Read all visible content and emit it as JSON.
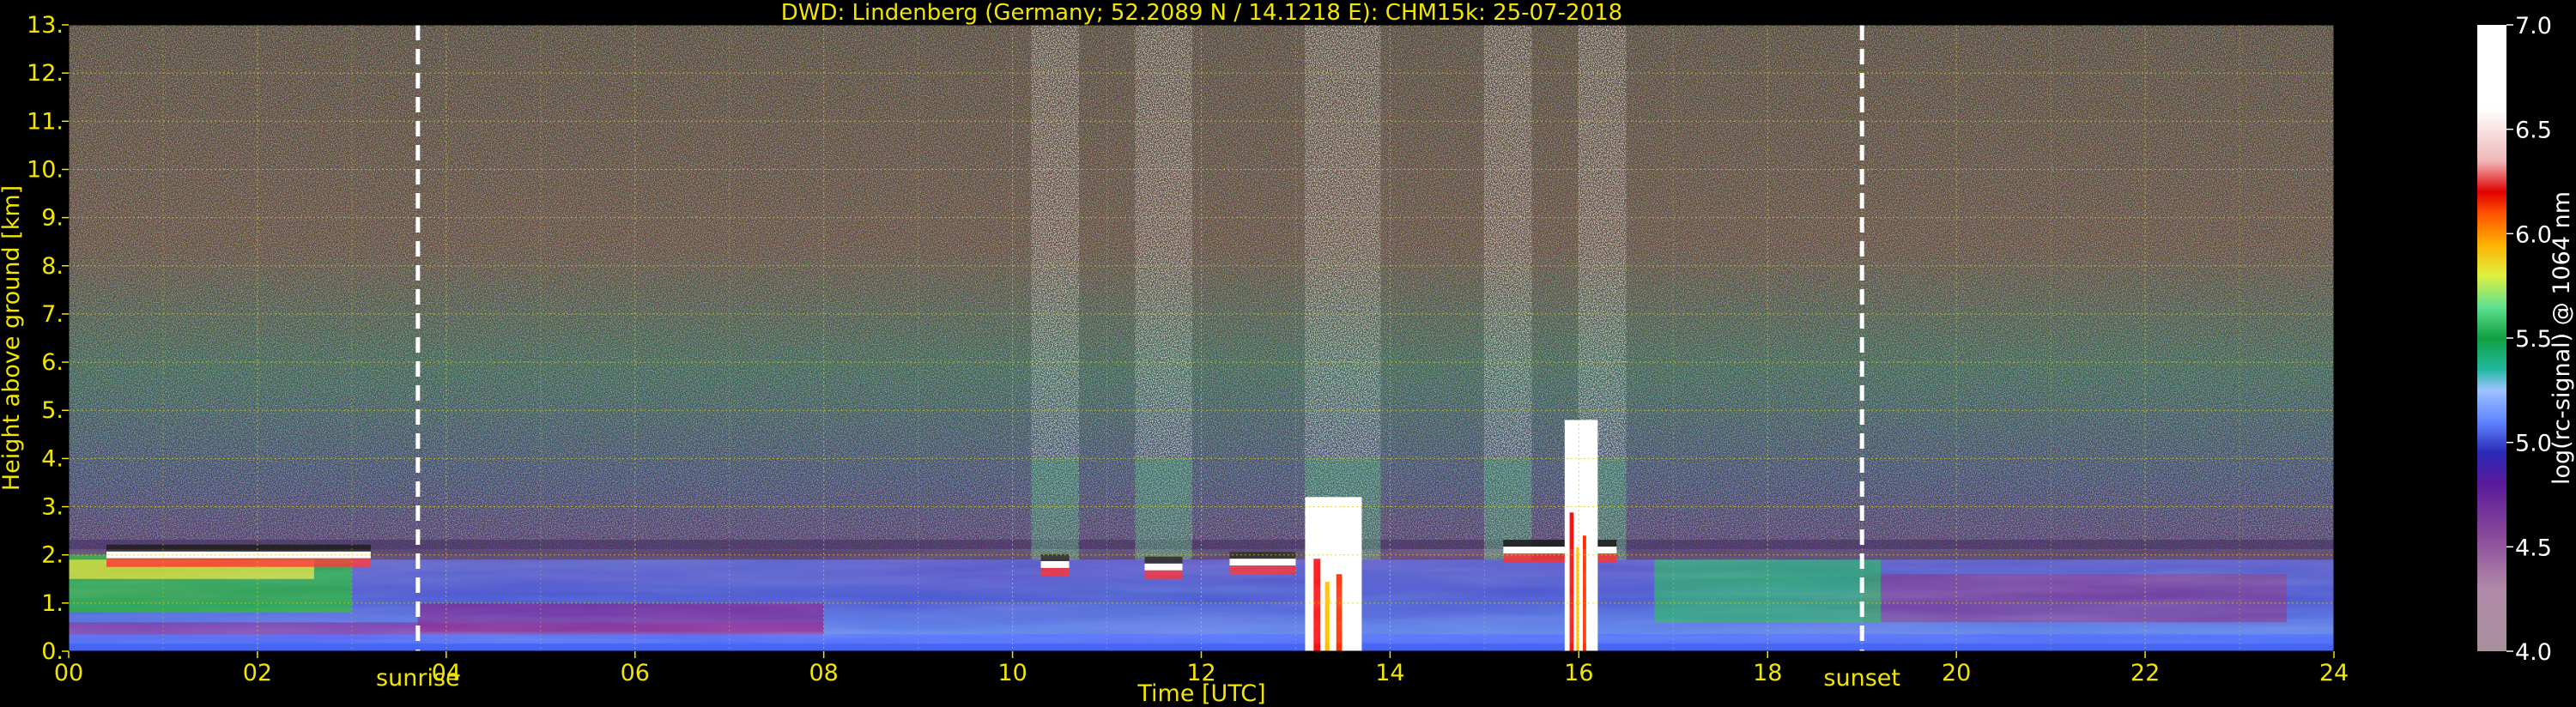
{
  "chart_data": {
    "type": "heatmap",
    "title": "DWD: Lindenberg (Germany; 52.2089 N / 14.1218 E):    CHM15k: 25-07-2018",
    "xlabel": "Time [UTC]",
    "ylabel": "Height above ground [km]",
    "xlim": [
      0,
      24
    ],
    "ylim": [
      0,
      13
    ],
    "x_ticks": [
      "00",
      "02",
      "04",
      "06",
      "08",
      "10",
      "12",
      "14",
      "16",
      "18",
      "20",
      "22",
      "24"
    ],
    "y_ticks": [
      "0.",
      "1.",
      "2.",
      "3.",
      "4.",
      "5.",
      "6.",
      "7.",
      "8.",
      "9.",
      "10.",
      "11.",
      "12.",
      "13."
    ],
    "grid": true,
    "annotations": [
      {
        "label": "sunrise",
        "x": 3.7
      },
      {
        "label": "sunset",
        "x": 19.0
      }
    ],
    "colorbar": {
      "label": "log(rc-signal) @ 1064 nm",
      "range": [
        4.0,
        7.0
      ],
      "ticks": [
        "4.0",
        "4.5",
        "5.0",
        "5.5",
        "6.0",
        "6.5",
        "7.0"
      ],
      "stops": [
        {
          "v": 4.0,
          "c": "#a8909c"
        },
        {
          "v": 4.3,
          "c": "#b08aa8"
        },
        {
          "v": 4.55,
          "c": "#8a4a9a"
        },
        {
          "v": 4.8,
          "c": "#5a1a9a"
        },
        {
          "v": 4.95,
          "c": "#2a2ab8"
        },
        {
          "v": 5.1,
          "c": "#5f86ff"
        },
        {
          "v": 5.25,
          "c": "#9ec2ff"
        },
        {
          "v": 5.35,
          "c": "#20b8a0"
        },
        {
          "v": 5.5,
          "c": "#10a040"
        },
        {
          "v": 5.65,
          "c": "#60e090"
        },
        {
          "v": 5.8,
          "c": "#e0f040"
        },
        {
          "v": 5.95,
          "c": "#ffb000"
        },
        {
          "v": 6.1,
          "c": "#ff5000"
        },
        {
          "v": 6.2,
          "c": "#e00000"
        },
        {
          "v": 6.35,
          "c": "#f0b8b8"
        },
        {
          "v": 6.6,
          "c": "#ffffff"
        },
        {
          "v": 7.0,
          "c": "#ffffff"
        }
      ]
    },
    "features": {
      "boundary_layer_top_km": 1.9,
      "cloud_base_km": [
        {
          "t0": 0.4,
          "t1": 3.2,
          "h": 2.0
        },
        {
          "t0": 10.3,
          "t1": 10.6,
          "h": 1.8
        },
        {
          "t0": 11.4,
          "t1": 11.8,
          "h": 1.75
        },
        {
          "t0": 12.3,
          "t1": 13.0,
          "h": 1.85
        },
        {
          "t0": 15.2,
          "t1": 16.4,
          "h": 2.1
        }
      ],
      "rain_shafts": [
        {
          "t0": 13.1,
          "t1": 13.7,
          "top_km": 3.2
        },
        {
          "t0": 15.85,
          "t1": 16.2,
          "top_km": 4.8
        }
      ],
      "cirrus_columns": [
        {
          "t0": 10.2,
          "t1": 10.7
        },
        {
          "t0": 11.3,
          "t1": 11.9
        },
        {
          "t0": 13.1,
          "t1": 13.9
        },
        {
          "t0": 15.0,
          "t1": 15.5
        },
        {
          "t0": 16.0,
          "t1": 16.5
        }
      ]
    }
  }
}
